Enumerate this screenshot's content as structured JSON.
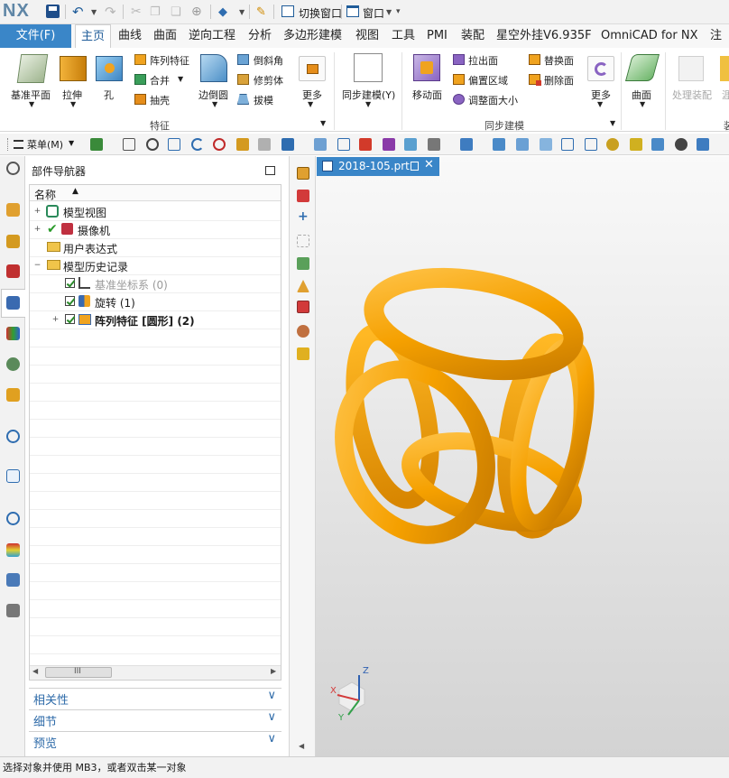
{
  "app": {
    "logo": "NX"
  },
  "quick_access": {
    "switch_window": "切换窗口",
    "window": "窗口"
  },
  "ribbon_tabs": {
    "file": "文件(F)",
    "items": [
      "主页",
      "曲线",
      "曲面",
      "逆向工程",
      "分析",
      "多边形建模",
      "视图",
      "工具",
      "PMI",
      "装配",
      "星空外挂V6.935F",
      "OmniCAD for NX",
      "注"
    ]
  },
  "ribbon": {
    "datum_plane": "基准平面",
    "extrude": "拉伸",
    "hole": "孔",
    "pattern_feature": "阵列特征",
    "unite": "合并",
    "shell": "抽壳",
    "edge_blend": "边倒圆",
    "chamfer": "倒斜角",
    "trim_body": "修剪体",
    "draft": "拔模",
    "more1": "更多",
    "group_feature": "特征",
    "sync_modeling": "同步建模(Y)",
    "move_face": "移动面",
    "pull_face": "拉出面",
    "offset_region": "偏置区域",
    "resize_face": "调整面大小",
    "replace_face": "替换面",
    "delete_face": "删除面",
    "more2": "更多",
    "group_sync": "同步建模",
    "surface": "曲面",
    "process_assembly": "处理装配",
    "cut_right": "涯",
    "cut_right2": "装"
  },
  "toolbar2": {
    "menu": "菜单(M)"
  },
  "navigator": {
    "title": "部件导航器",
    "column_name": "名称",
    "nodes": {
      "model_views": "模型视图",
      "cameras": "摄像机",
      "user_expressions": "用户表达式",
      "model_history": "模型历史记录",
      "datum_csys": "基准坐标系 (0)",
      "revolve": "旋转 (1)",
      "pattern": "阵列特征 [圆形] (2)"
    },
    "scroll_thumb": "III",
    "panels": [
      "相关性",
      "细节",
      "预览"
    ]
  },
  "document": {
    "tab_title": "2018-105.prt"
  },
  "triad": {
    "x": "X",
    "y": "Y",
    "z": "Z"
  },
  "status": {
    "text": "选择对象并使用 MB3，或者双击某一对象"
  },
  "colors": {
    "accent": "#3a86c8",
    "model": "#f5a000"
  }
}
